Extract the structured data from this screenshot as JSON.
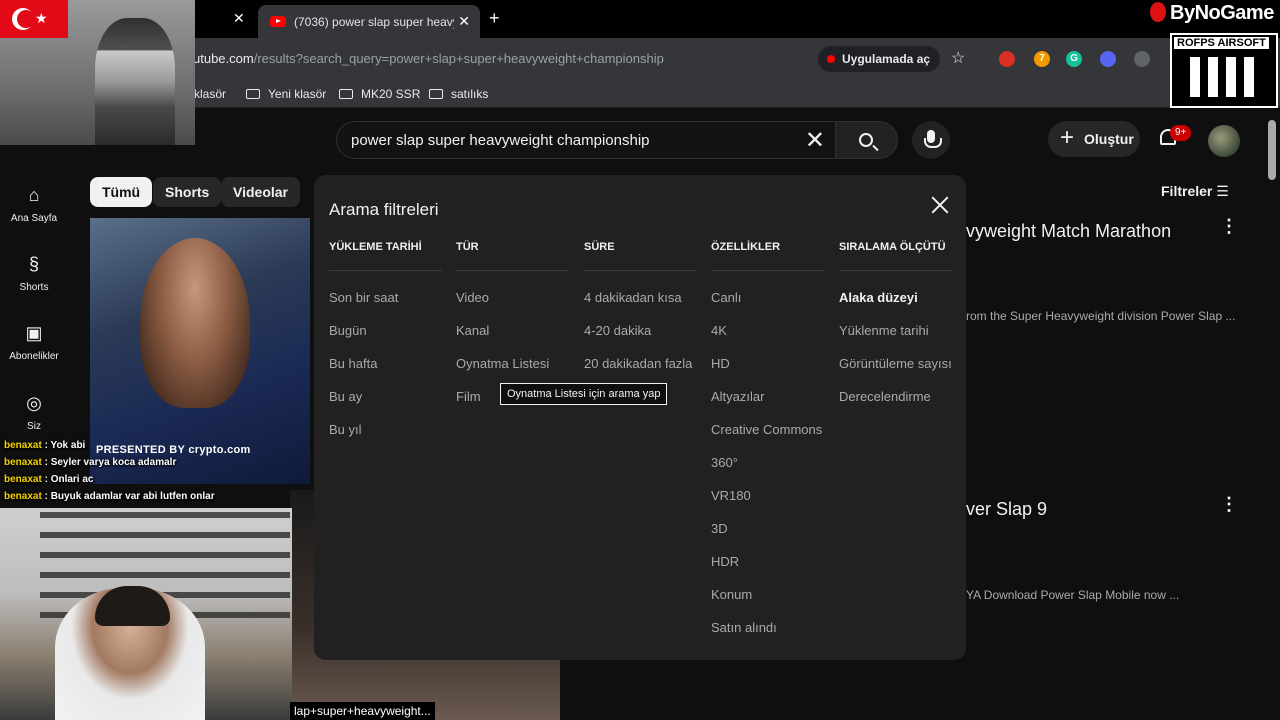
{
  "browser": {
    "active_tab_title": "(7036) power slap super heavy",
    "url_domain": "utube.com",
    "url_rest": "/results?search_query=power+slap+super+heavyweight+championship",
    "open_in_app": "Uygulamada aç",
    "bookmarks": [
      "klasör",
      "Yeni klasör",
      "MK20 SSR",
      "satılıks"
    ]
  },
  "header": {
    "search_query": "power slap super heavyweight championship",
    "create_label": "Oluştur",
    "notif_badge": "9+"
  },
  "leftnav": {
    "items": [
      {
        "label": "Ana Sayfa",
        "icon": "home-icon"
      },
      {
        "label": "Shorts",
        "icon": "shorts-icon"
      },
      {
        "label": "Abonelikler",
        "icon": "subscriptions-icon"
      },
      {
        "label": "Siz",
        "icon": "you-icon"
      }
    ]
  },
  "chips": [
    "Tümü",
    "Shorts",
    "Videolar"
  ],
  "filters_label": "Filtreler",
  "results": [
    {
      "title_fragment": "vyweight Match Marathon",
      "desc_fragment": "rom the Super Heavyweight division Power Slap ..."
    },
    {
      "title_fragment": "ver Slap 9",
      "desc_fragment": "YA Download Power Slap Mobile now ..."
    }
  ],
  "thumb_overlay": "PRESENTED BY  crypto.com",
  "modal": {
    "title": "Arama filtreleri",
    "columns": [
      {
        "header": "YÜKLEME TARİHİ",
        "options": [
          "Son bir saat",
          "Bugün",
          "Bu hafta",
          "Bu ay",
          "Bu yıl"
        ]
      },
      {
        "header": "TÜR",
        "options": [
          "Video",
          "Kanal",
          "Oynatma Listesi",
          "Film"
        ]
      },
      {
        "header": "SÜRE",
        "options": [
          "4 dakikadan kısa",
          "4-20 dakika",
          "20 dakikadan fazla"
        ]
      },
      {
        "header": "ÖZELLİKLER",
        "options": [
          "Canlı",
          "4K",
          "HD",
          "Altyazılar",
          "Creative Commons",
          "360°",
          "VR180",
          "3D",
          "HDR",
          "Konum",
          "Satın alındı"
        ]
      },
      {
        "header": "SIRALAMA ÖLÇÜTÜ",
        "options": [
          "Alaka düzeyi",
          "Yüklenme tarihi",
          "Görüntüleme sayısı",
          "Derecelendirme"
        ],
        "selected": "Alaka düzeyi"
      }
    ],
    "tooltip": "Oynatma Listesi için arama yap"
  },
  "stream": {
    "brand": "ByNoGame",
    "sponsor": "ROFPS AIRSOFT",
    "chat": [
      {
        "user": "benaxat",
        "msg": "Yok abi"
      },
      {
        "user": "benaxat",
        "msg": "Seyler varya koca adamalr"
      },
      {
        "user": "benaxat",
        "msg": "Onlari ac"
      },
      {
        "user": "benaxat",
        "msg": "Buyuk adamlar var abi lutfen onlar"
      }
    ],
    "bottom_url": "lap+super+heavyweight..."
  }
}
